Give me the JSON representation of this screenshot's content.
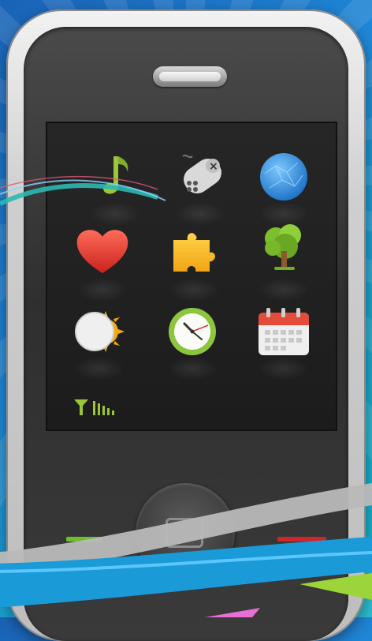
{
  "device": {
    "accent_green": "#8bc53f",
    "accent_red": "#d0262b"
  },
  "screen": {
    "icons": [
      {
        "name": "music-note-icon"
      },
      {
        "name": "gamepad-icon"
      },
      {
        "name": "globe-icon"
      },
      {
        "name": "heart-icon"
      },
      {
        "name": "puzzle-piece-icon"
      },
      {
        "name": "tree-icon"
      },
      {
        "name": "weather-moon-sun-icon"
      },
      {
        "name": "clock-icon"
      },
      {
        "name": "calendar-icon"
      }
    ],
    "status": {
      "signal_icon": "antenna-signal-icon",
      "signal_bars": 5
    }
  }
}
